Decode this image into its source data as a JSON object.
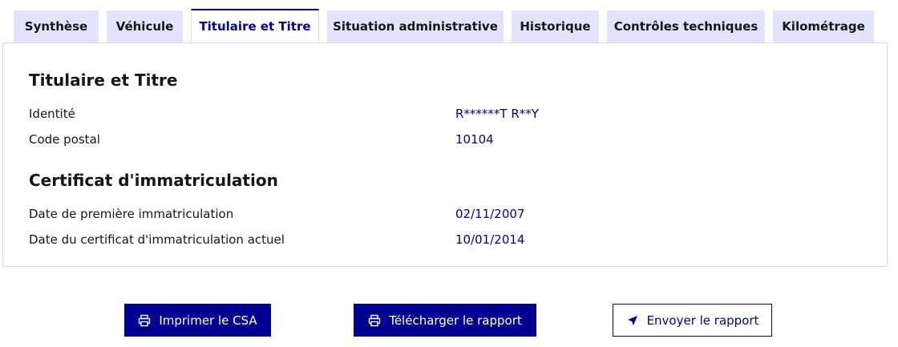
{
  "tabs": [
    {
      "label": "Synthèse",
      "active": false
    },
    {
      "label": "Véhicule",
      "active": false
    },
    {
      "label": "Titulaire et Titre",
      "active": true
    },
    {
      "label": "Situation administrative",
      "active": false
    },
    {
      "label": "Historique",
      "active": false
    },
    {
      "label": "Contrôles techniques",
      "active": false
    },
    {
      "label": "Kilométrage",
      "active": false
    }
  ],
  "holder": {
    "title": "Titulaire et Titre",
    "identity_label": "Identité",
    "identity_value": "R******T R**Y",
    "postal_label": "Code postal",
    "postal_value": "10104"
  },
  "certificate": {
    "title": "Certificat d'immatriculation",
    "first_reg_label": "Date de première immatriculation",
    "first_reg_value": "02/11/2007",
    "current_label": "Date du certificat d'immatriculation actuel",
    "current_value": "10/01/2014"
  },
  "actions": {
    "print_label": "Imprimer le CSA",
    "download_label": "Télécharger le rapport",
    "send_label": "Envoyer le rapport"
  },
  "colors": {
    "accent": "#000091",
    "tab_bg": "#e3e3fd",
    "text": "#161616"
  },
  "icons": {
    "print": "printer-icon",
    "download": "printer-icon",
    "send": "send-arrow-icon"
  }
}
